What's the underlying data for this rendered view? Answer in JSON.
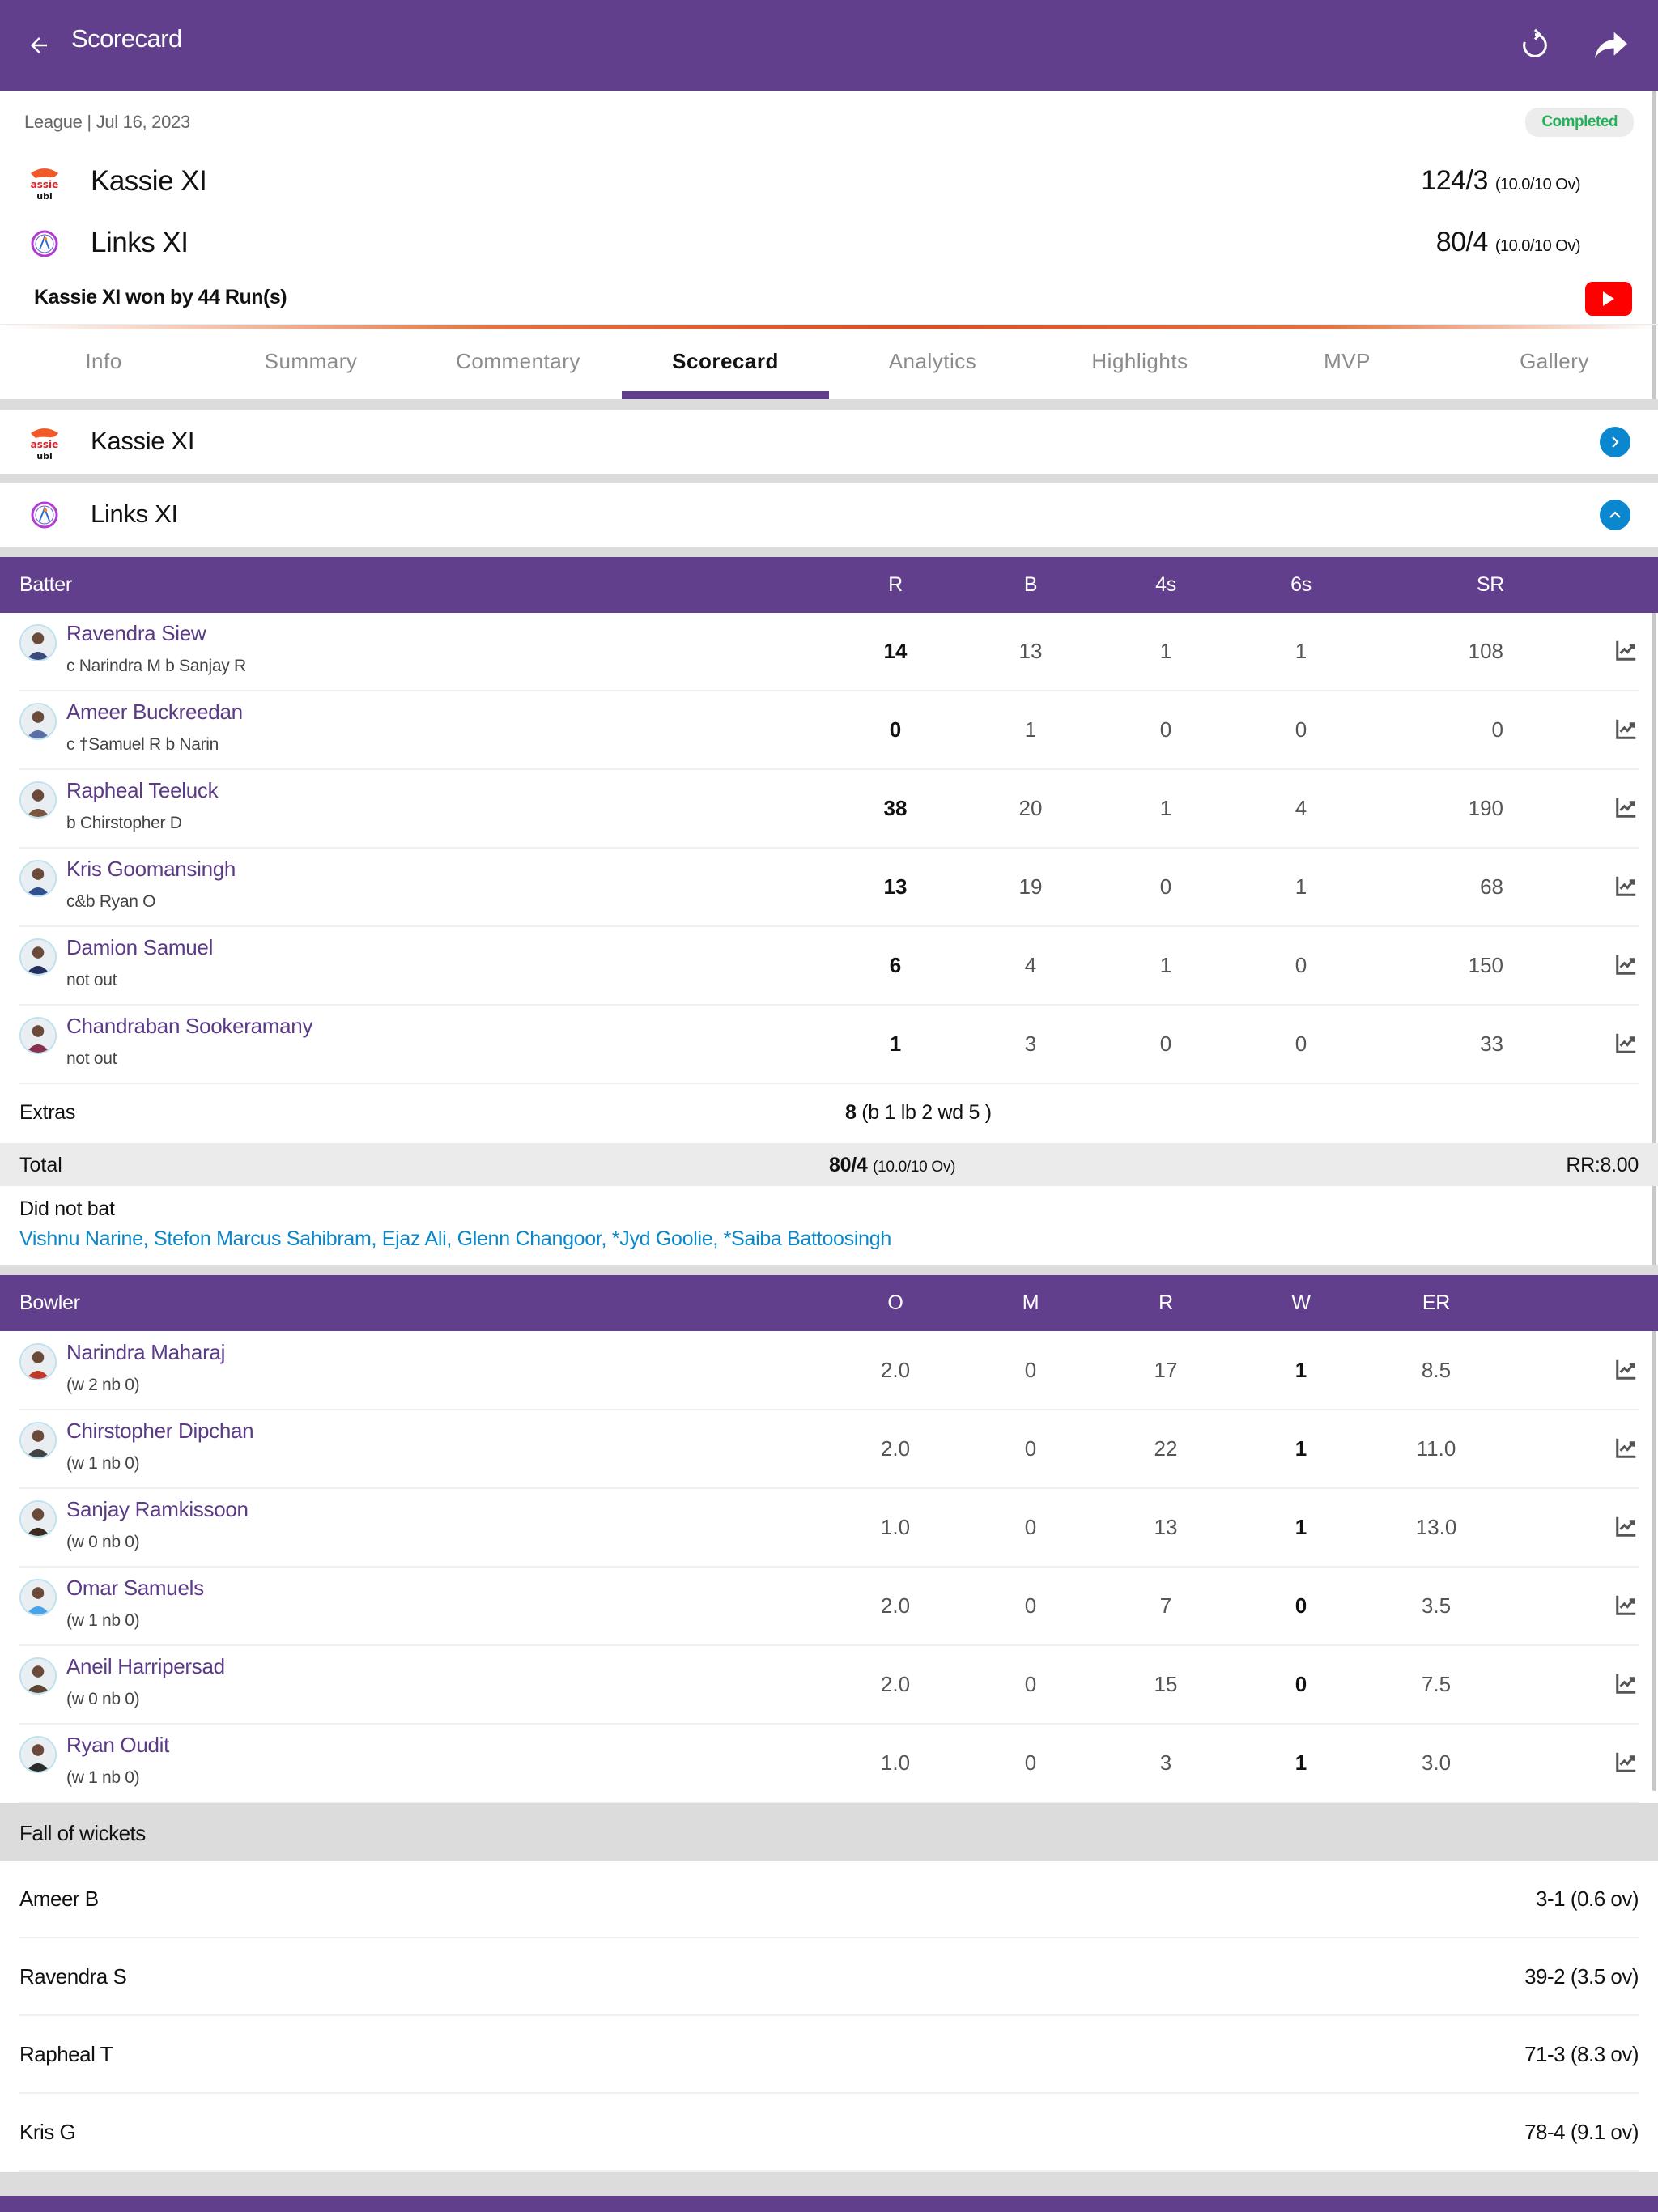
{
  "appbar": {
    "title": "Scorecard",
    "icons": [
      "back-arrow-icon",
      "refresh-icon",
      "share-icon"
    ]
  },
  "match": {
    "meta": "League | Jul 16, 2023",
    "status": "Completed",
    "teams": [
      {
        "name": "Kassie XI",
        "score": "124/3",
        "overs": "(10.0/10 Ov)"
      },
      {
        "name": "Links XI",
        "score": "80/4",
        "overs": "(10.0/10 Ov)"
      }
    ],
    "result": "Kassie XI won by 44 Run(s)"
  },
  "colors": {
    "brand": "#613f8d",
    "status_green": "#27b05a",
    "link_blue": "#0b87c8",
    "youtube_red": "#ff0000"
  },
  "tabs": [
    {
      "label": "Info"
    },
    {
      "label": "Summary"
    },
    {
      "label": "Commentary"
    },
    {
      "label": "Scorecard",
      "active": true
    },
    {
      "label": "Analytics"
    },
    {
      "label": "Highlights"
    },
    {
      "label": "MVP"
    },
    {
      "label": "Gallery"
    }
  ],
  "innings": [
    {
      "team": "Kassie XI",
      "expanded": false
    },
    {
      "team": "Links XI",
      "expanded": true
    }
  ],
  "batting": {
    "headers": [
      "Batter",
      "R",
      "B",
      "4s",
      "6s",
      "SR"
    ],
    "rows": [
      {
        "name": "Ravendra Siew",
        "dismissal": "c Narindra M b Sanjay R",
        "r": "14",
        "b": "13",
        "fours": "1",
        "sixes": "1",
        "sr": "108"
      },
      {
        "name": "Ameer Buckreedan",
        "dismissal": "c †Samuel R b Narin",
        "r": "0",
        "b": "1",
        "fours": "0",
        "sixes": "0",
        "sr": "0"
      },
      {
        "name": "Rapheal Teeluck",
        "dismissal": "b Chirstopher D",
        "r": "38",
        "b": "20",
        "fours": "1",
        "sixes": "4",
        "sr": "190"
      },
      {
        "name": "Kris Goomansingh",
        "dismissal": "c&b Ryan O",
        "r": "13",
        "b": "19",
        "fours": "0",
        "sixes": "1",
        "sr": "68"
      },
      {
        "name": "Damion Samuel",
        "dismissal": "not out",
        "r": "6",
        "b": "4",
        "fours": "1",
        "sixes": "0",
        "sr": "150"
      },
      {
        "name": "Chandraban Sookeramany",
        "dismissal": "not out",
        "r": "1",
        "b": "3",
        "fours": "0",
        "sixes": "0",
        "sr": "33"
      }
    ],
    "extras_label": "Extras",
    "extras_total": "8",
    "extras_detail": "(b 1 lb 2 wd 5 )",
    "total_label": "Total",
    "total_score": "80/4",
    "total_overs": "(10.0/10 Ov)",
    "run_rate": "RR:8.00",
    "dnb_label": "Did not bat",
    "dnb_list": "Vishnu Narine, Stefon Marcus Sahibram, Ejaz Ali, Glenn Changoor, *Jyd Goolie, *Saiba Battoosingh"
  },
  "bowling": {
    "headers": [
      "Bowler",
      "O",
      "M",
      "R",
      "W",
      "ER"
    ],
    "rows": [
      {
        "name": "Narindra Maharaj",
        "extras": "(w 2 nb 0)",
        "o": "2.0",
        "m": "0",
        "r": "17",
        "w": "1",
        "er": "8.5"
      },
      {
        "name": "Chirstopher Dipchan",
        "extras": "(w 1 nb 0)",
        "o": "2.0",
        "m": "0",
        "r": "22",
        "w": "1",
        "er": "11.0"
      },
      {
        "name": "Sanjay Ramkissoon",
        "extras": "(w 0 nb 0)",
        "o": "1.0",
        "m": "0",
        "r": "13",
        "w": "1",
        "er": "13.0"
      },
      {
        "name": "Omar Samuels",
        "extras": "(w 1 nb 0)",
        "o": "2.0",
        "m": "0",
        "r": "7",
        "w": "0",
        "er": "3.5"
      },
      {
        "name": "Aneil Harripersad",
        "extras": "(w 0 nb 0)",
        "o": "2.0",
        "m": "0",
        "r": "15",
        "w": "0",
        "er": "7.5"
      },
      {
        "name": "Ryan Oudit",
        "extras": "(w 1 nb 0)",
        "o": "1.0",
        "m": "0",
        "r": "3",
        "w": "1",
        "er": "3.0"
      }
    ]
  },
  "fall_of_wickets": {
    "title": "Fall of wickets",
    "rows": [
      {
        "batter": "Ameer B",
        "at": "3-1 (0.6 ov)"
      },
      {
        "batter": "Ravendra S",
        "at": "39-2 (3.5 ov)"
      },
      {
        "batter": "Rapheal T",
        "at": "71-3 (8.3 ov)"
      },
      {
        "batter": "Kris G",
        "at": "78-4 (9.1 ov)"
      }
    ]
  }
}
